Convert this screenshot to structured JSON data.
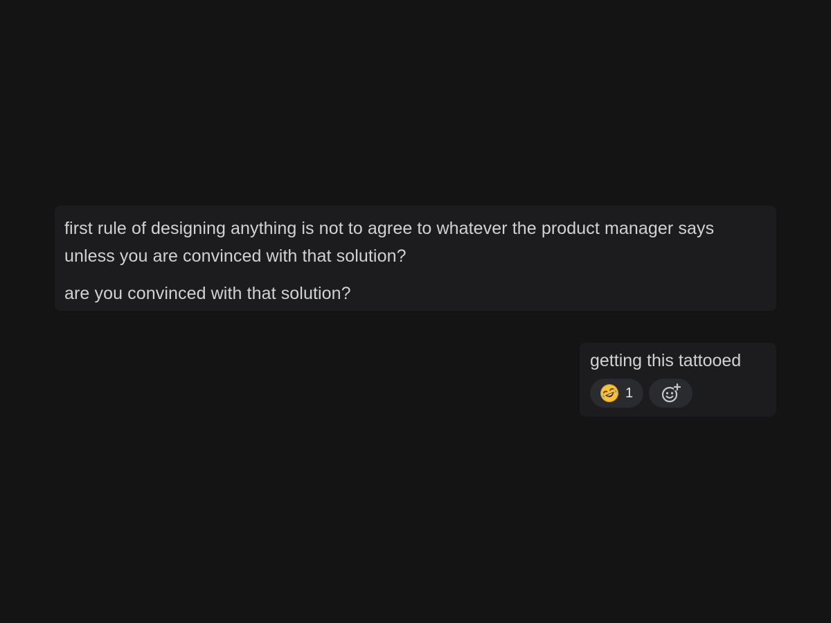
{
  "messages": [
    {
      "lines": [
        "first rule of designing anything is not to agree to whatever the product manager says unless you are convinced with that solution?",
        "are you convinced with that solution?"
      ]
    },
    {
      "text": "getting this tattooed",
      "reactions": [
        {
          "emoji_icon": "rolling-on-floor-laughing-emoji",
          "count": "1"
        }
      ],
      "add_reaction_icon": "add-reaction-icon"
    }
  ],
  "colors": {
    "background": "#141414",
    "bubble": "#1c1c1f",
    "pill": "#2a2b2e",
    "text": "#d1d2d3"
  }
}
